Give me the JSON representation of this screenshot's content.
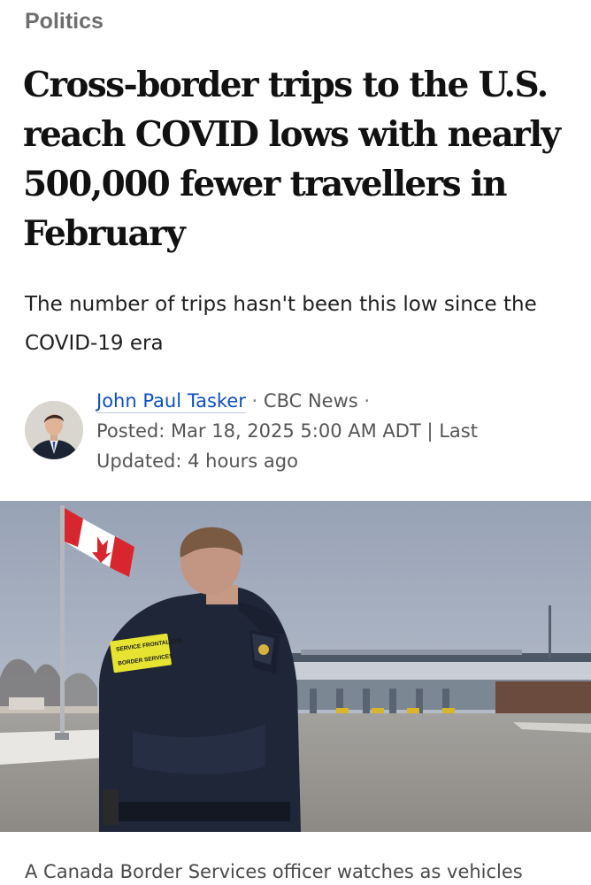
{
  "article": {
    "section": "Politics",
    "headline": "Cross-border trips to the U.S. reach COVID lows with nearly 500,000 fewer travellers in February",
    "deck": "The number of trips hasn't been this low since the COVID-19 era",
    "byline": {
      "author": "John Paul Tasker",
      "separator": " · ",
      "outlet": "CBC News",
      "posted": "Posted: Mar 18, 2025 5:00 AM ADT",
      "divider": " | ",
      "updated": "Last Updated: 4 hours ago"
    },
    "hero_image": {
      "patch_line_1": "SERVICE FRONTALIERS",
      "patch_line_2": "BORDER SERVICES"
    },
    "caption": "A Canada Border Services officer watches as vehicles"
  },
  "colors": {
    "link": "#0b4fc4",
    "section": "#6e6e6e",
    "headline": "#111111",
    "sky": "#a9b3c3",
    "uniform": "#1f2638",
    "patch": "#e6e430"
  },
  "icons": {
    "avatar": "author-headshot",
    "flag": "canada-flag"
  }
}
